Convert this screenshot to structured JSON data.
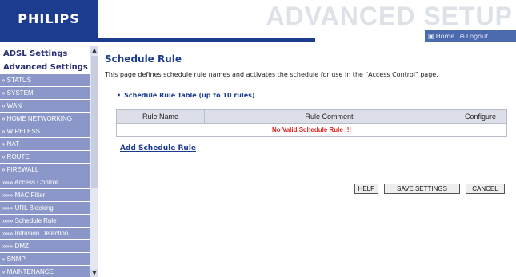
{
  "header": {
    "logo": "PHILIPS",
    "title": "ADVANCED SETUP",
    "home": "Home",
    "logout": "Logout"
  },
  "sidebar": {
    "adsl_settings": "ADSL Settings",
    "advanced_settings": "Advanced Settings",
    "items": [
      {
        "label": "» STATUS"
      },
      {
        "label": "» SYSTEM"
      },
      {
        "label": "» WAN"
      },
      {
        "label": "» HOME NETWORKING"
      },
      {
        "label": "» WIRELESS"
      },
      {
        "label": "» NAT"
      },
      {
        "label": "» ROUTE"
      },
      {
        "label": "» FIREWALL"
      },
      {
        "label": "»»» Access Control"
      },
      {
        "label": "»»» MAC Filter"
      },
      {
        "label": "»»» URL Blocking"
      },
      {
        "label": "»»» Schedule Rule"
      },
      {
        "label": "»»» Intrusion Detection"
      },
      {
        "label": "»»» DMZ"
      },
      {
        "label": "» SNMP"
      },
      {
        "label": "» MAINTENANCE"
      }
    ]
  },
  "main": {
    "title": "Schedule Rule",
    "description": "This page defines schedule rule names and activates the schedule for use in the \"Access Control\" page.",
    "table_title": "Schedule Rule Table (up to 10 rules)",
    "columns": [
      "Rule Name",
      "Rule Comment",
      "Configure"
    ],
    "empty_message": "No Valid Schedule Rule !!!",
    "add_link": "Add Schedule Rule"
  },
  "buttons": {
    "help": "HELP",
    "save": "SAVE SETTINGS",
    "cancel": "CANCEL"
  },
  "colors": {
    "brand": "#1c3c8f",
    "sidebar_item": "#8b97c8",
    "error": "#e02424"
  }
}
